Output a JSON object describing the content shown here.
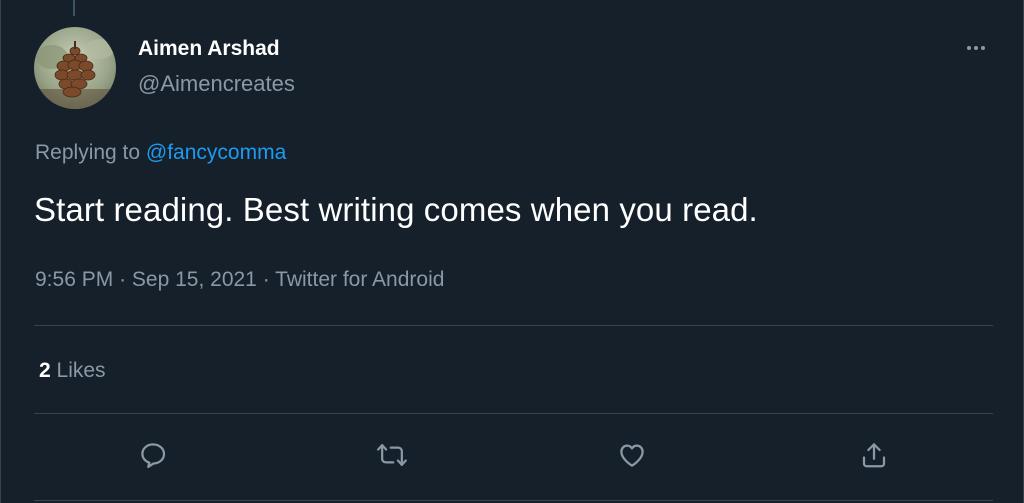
{
  "author": {
    "display_name": "Aimen Arshad",
    "handle": "@Aimencreates",
    "avatar": "pinecone-avatar"
  },
  "reply": {
    "prefix": "Replying to",
    "mention": "@fancycomma"
  },
  "tweet": {
    "text": "Start reading. Best writing comes when you read.",
    "time": "9:56 PM",
    "separator_1": "·",
    "date": "Sep 15, 2021",
    "separator_2": "·",
    "source": "Twitter for Android"
  },
  "stats": {
    "likes_count": "2",
    "likes_label": "Likes"
  },
  "actions": [
    {
      "icon": "reply-icon"
    },
    {
      "icon": "retweet-icon"
    },
    {
      "icon": "like-icon"
    },
    {
      "icon": "share-icon"
    }
  ],
  "colors": {
    "background": "#15202b",
    "accent": "#1d9bf0",
    "secondary_text": "#8b98a5",
    "divider": "#38444d"
  }
}
